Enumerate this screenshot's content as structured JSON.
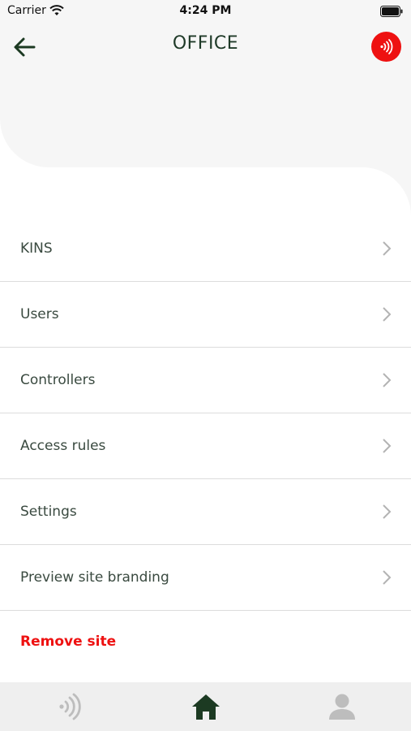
{
  "status_bar": {
    "carrier": "Carrier",
    "time": "4:24 PM",
    "wifi_icon": "wifi-icon",
    "battery_icon": "battery-full-icon"
  },
  "header": {
    "title": "OFFICE",
    "back_icon": "arrow-left-icon",
    "nfc_icon": "nfc-signal-icon",
    "accent": "#ee1111"
  },
  "menu": {
    "items": [
      {
        "label": "KINS"
      },
      {
        "label": "Users"
      },
      {
        "label": "Controllers"
      },
      {
        "label": "Access rules"
      },
      {
        "label": "Settings"
      },
      {
        "label": "Preview site branding"
      }
    ],
    "remove_label": "Remove site"
  },
  "tab_bar": {
    "tabs": [
      {
        "icon": "nfc-tap-icon",
        "active": false
      },
      {
        "icon": "home-icon",
        "active": true
      },
      {
        "icon": "user-icon",
        "active": false
      }
    ],
    "active_color": "#1c3a22",
    "inactive_color": "#bdbdbd"
  }
}
